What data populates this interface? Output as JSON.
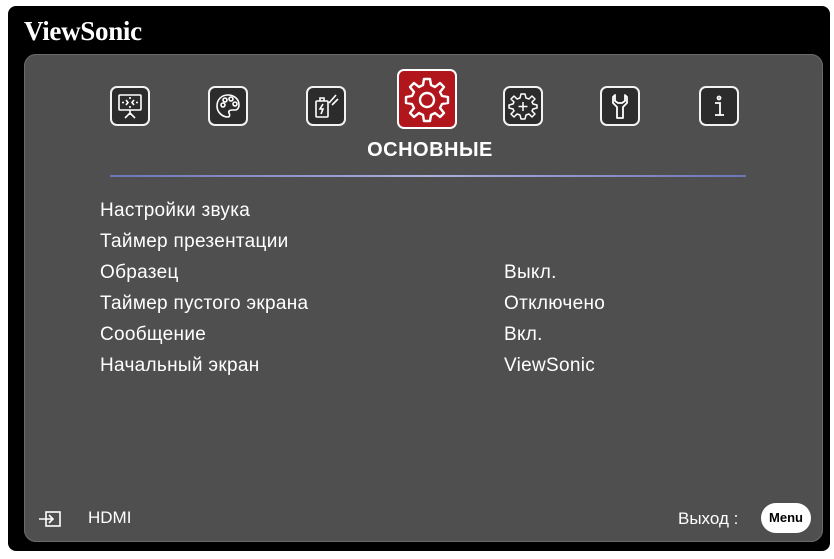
{
  "brand": "ViewSonic",
  "active_tab_label": "ОСНОВНЫЕ",
  "tabs": [
    {
      "icon": "display-icon"
    },
    {
      "icon": "palette-icon"
    },
    {
      "icon": "power-management-icon"
    },
    {
      "icon": "gear-icon",
      "active": true
    },
    {
      "icon": "advanced-gear-icon"
    },
    {
      "icon": "wrench-icon"
    },
    {
      "icon": "info-icon"
    }
  ],
  "menu_items": [
    {
      "label": "Настройки звука",
      "value": ""
    },
    {
      "label": "Таймер презентации",
      "value": ""
    },
    {
      "label": "Образец",
      "value": "Выкл."
    },
    {
      "label": "Таймер пустого экрана",
      "value": "Отключено"
    },
    {
      "label": "Сообщение",
      "value": "Вкл."
    },
    {
      "label": "Начальный экран",
      "value": "ViewSonic"
    }
  ],
  "footer": {
    "source": "HDMI",
    "exit_label": "Выход :",
    "menu_button": "Menu"
  },
  "colors": {
    "panel": "#4f4f4f",
    "active_tab": "#b0161b",
    "divider": "#8c93cc",
    "text": "#ffffff"
  }
}
